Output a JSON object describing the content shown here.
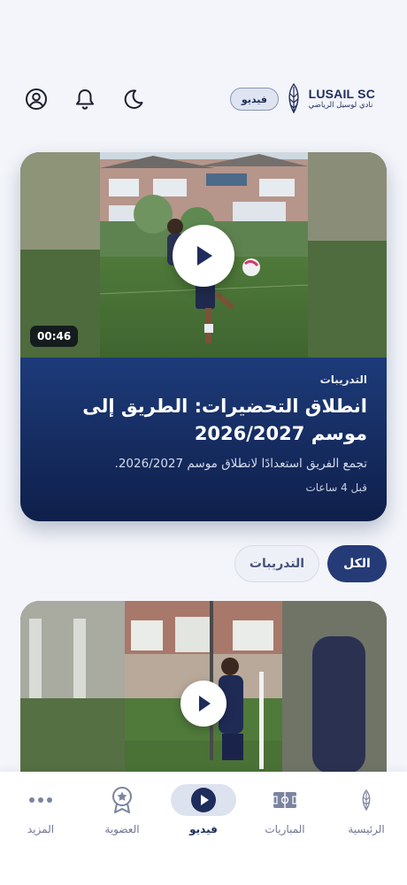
{
  "header": {
    "logo_name": "LUSAIL SC",
    "logo_sub": "نادي لوسيل الرياضي",
    "section_pill": "فيديو",
    "icons": [
      "moon-icon",
      "bell-icon",
      "user-circle-icon"
    ]
  },
  "featured": {
    "duration": "00:46",
    "category": "التدريبات",
    "title": "انطلاق التحضيرات: الطريق إلى موسم 2026/2027",
    "description": "تجمع الفريق استعدادًا لانطلاق موسم 2026/2027.",
    "time_ago": "قبل 4 ساعات"
  },
  "filters": {
    "all": "الكل",
    "training": "التدريبات",
    "selected": "الكل"
  },
  "nav": {
    "items": [
      {
        "label": "الرئيسية",
        "icon": "home-logo-icon"
      },
      {
        "label": "المباريات",
        "icon": "pitch-icon"
      },
      {
        "label": "فيديو",
        "icon": "play-icon"
      },
      {
        "label": "العضوية",
        "icon": "membership-badge-icon"
      },
      {
        "label": "المزيد",
        "icon": "more-dots-icon"
      }
    ],
    "active": "فيديو"
  },
  "colors": {
    "brand_navy": "#1e2d5c",
    "accent_blue": "#243b77",
    "background": "#f3f5fa"
  }
}
